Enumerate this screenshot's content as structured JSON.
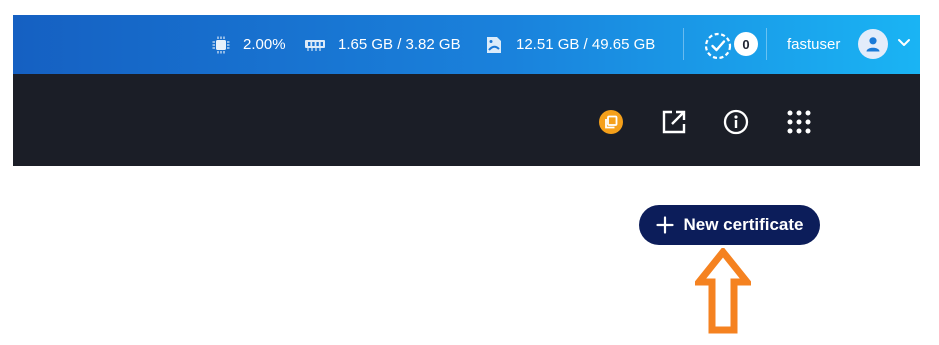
{
  "header": {
    "cpu": {
      "icon": "cpu-icon",
      "value": "2.00%"
    },
    "memory": {
      "icon": "memory-icon",
      "value": "1.65 GB / 3.82 GB"
    },
    "storage": {
      "icon": "storage-icon",
      "value": "12.51 GB / 49.65 GB"
    },
    "tasks": {
      "icon": "task-check-icon",
      "count": "0"
    },
    "user": {
      "name": "fastuser",
      "avatar_icon": "user-avatar-icon",
      "menu_icon": "chevron-down-icon"
    }
  },
  "toolbar": {
    "items": [
      {
        "icon": "copy-badge-icon",
        "color": "#f5a01a"
      },
      {
        "icon": "open-external-icon"
      },
      {
        "icon": "info-icon"
      },
      {
        "icon": "apps-grid-icon"
      }
    ]
  },
  "main": {
    "new_certificate": {
      "label": "New certificate",
      "icon": "plus-icon"
    }
  },
  "annotation": {
    "icon": "up-arrow-icon",
    "color": "#f58220"
  },
  "colors": {
    "header_gradient_start": "#1560c2",
    "header_gradient_end": "#1ab4f4",
    "toolbar_bg": "#1b1e27",
    "primary_button": "#0c1d5a"
  }
}
